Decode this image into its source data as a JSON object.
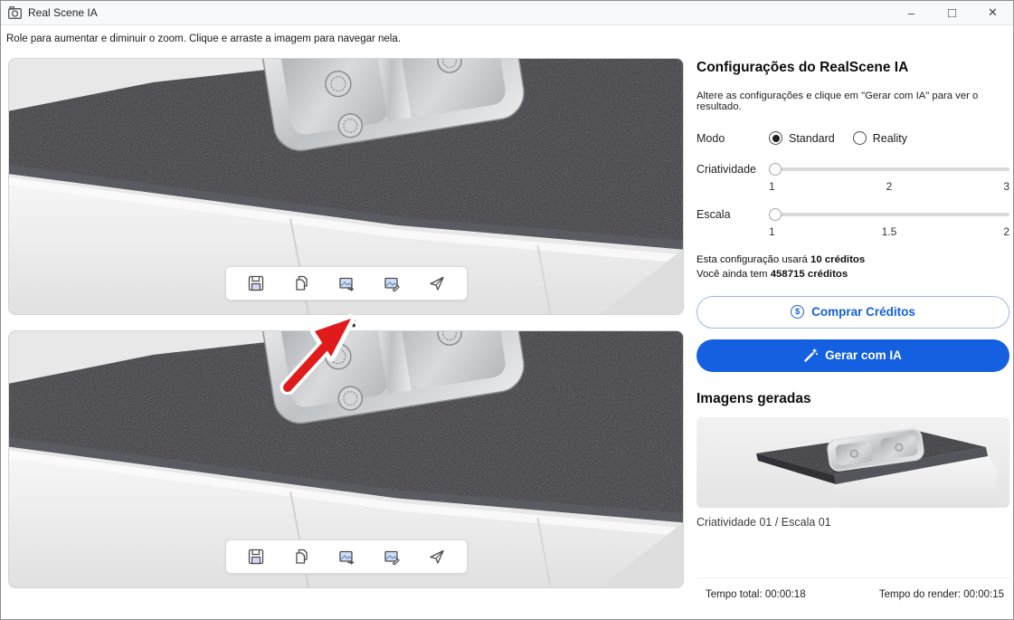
{
  "window": {
    "title": "Real Scene IA",
    "controls": {
      "minimize": "–",
      "maximize": "□",
      "close": "✕"
    }
  },
  "instructions": "Role para aumentar e diminuir o zoom. Clique e arraste a imagem para navegar nela.",
  "viewer": {
    "toolbar_icons": [
      "save",
      "copy",
      "export-image",
      "edit-image",
      "send"
    ],
    "panel_count": 2,
    "divider_handle": "drag-dots"
  },
  "settings": {
    "title": "Configurações do RealScene IA",
    "subtitle": "Altere as configurações e clique em \"Gerar com IA\" para ver o resultado.",
    "mode": {
      "label": "Modo",
      "options": [
        {
          "label": "Standard",
          "selected": true
        },
        {
          "label": "Reality",
          "selected": false
        }
      ]
    },
    "sliders": [
      {
        "label": "Criatividade",
        "ticks": [
          "1",
          "2",
          "3"
        ],
        "value": "1"
      },
      {
        "label": "Escala",
        "ticks": [
          "1",
          "1.5",
          "2"
        ],
        "value": "1"
      }
    ],
    "credits": {
      "usage_prefix": "Esta configuração usará ",
      "usage_bold": "10 créditos",
      "balance_prefix": "Você ainda tem ",
      "balance_bold": "458715 créditos"
    },
    "buy_button": {
      "icon": "$",
      "label": "Comprar Créditos"
    },
    "generate_button": {
      "icon": "magic-wand",
      "label": "Gerar com IA"
    },
    "accent_color": "#1560e0"
  },
  "generated": {
    "title": "Imagens geradas",
    "caption": "Criatividade 01 / Escala 01"
  },
  "footer": {
    "total_time": "Tempo total: 00:00:18",
    "render_time": "Tempo do render: 00:00:15"
  }
}
